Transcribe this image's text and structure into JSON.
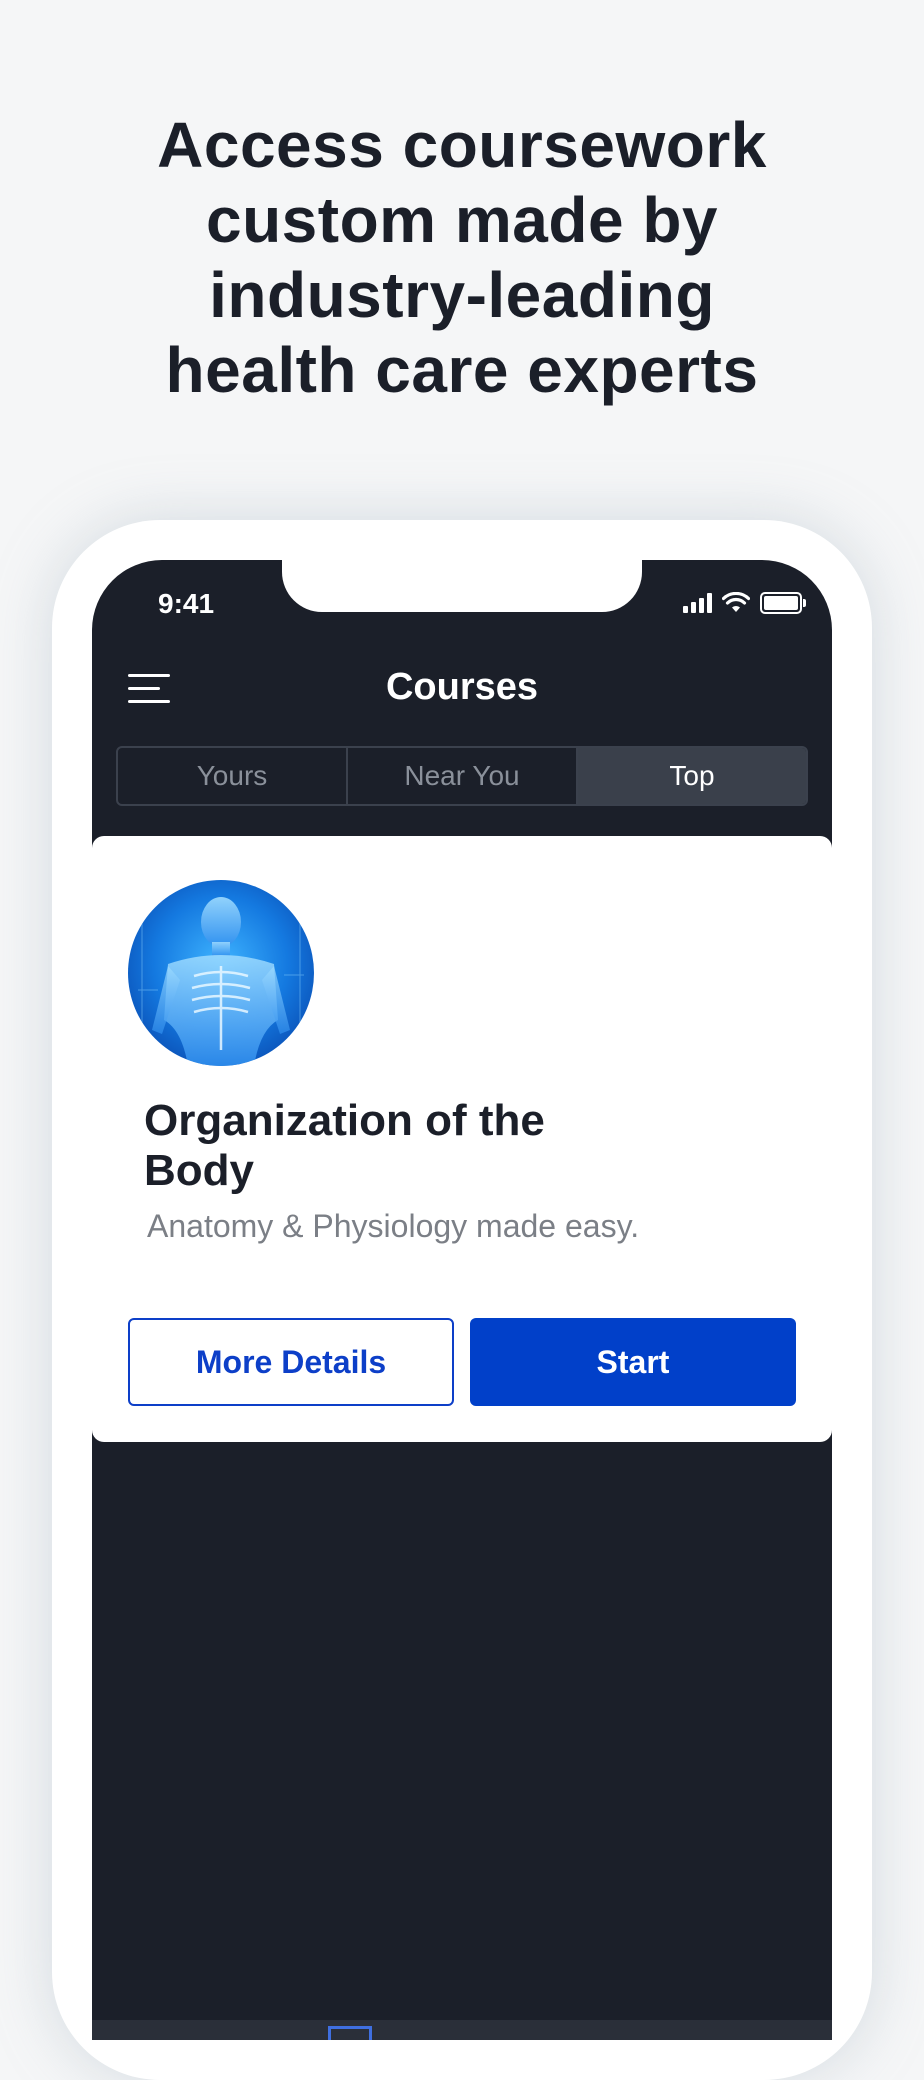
{
  "headline": "Access coursework\ncustom made by\nindustry-leading\nhealth care experts",
  "status_bar": {
    "time": "9:41"
  },
  "nav": {
    "title": "Courses"
  },
  "segments": [
    {
      "label": "Yours",
      "active": false
    },
    {
      "label": "Near You",
      "active": false
    },
    {
      "label": "Top",
      "active": true
    }
  ],
  "course": {
    "title": "Organization of the Body",
    "subtitle": "Anatomy & Physiology made easy.",
    "more_details_label": "More Details",
    "start_label": "Start"
  },
  "colors": {
    "accent": "#0140c9",
    "app_background": "#1b1f29",
    "page_background": "#f5f6f7"
  }
}
